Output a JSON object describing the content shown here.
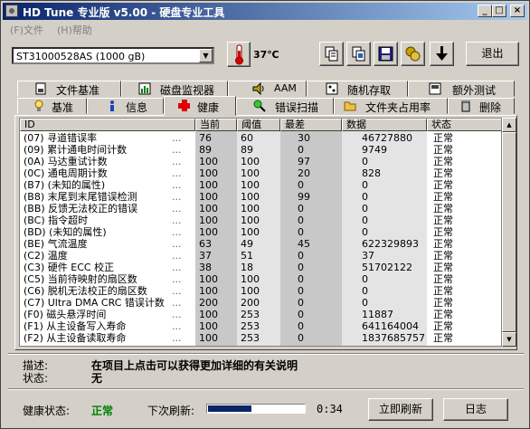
{
  "window": {
    "title": "HD Tune 专业版 v5.00 - 硬盘专业工具",
    "controls": {
      "minimize": "_",
      "maximize": "□",
      "close": "×"
    }
  },
  "menu": {
    "items": [
      "(F)文件",
      "(H)帮助"
    ]
  },
  "toolbar": {
    "drive": "ST31000528AS (1000 gB)",
    "temperature": "37℃",
    "exit_label": "退出",
    "icons": [
      "copy-text-icon",
      "copy-screen-icon",
      "save-icon",
      "options-icon",
      "download-icon"
    ]
  },
  "tabs": {
    "row1": [
      {
        "label": "文件基准",
        "icon": "file-benchmark-icon"
      },
      {
        "label": "磁盘监视器",
        "icon": "disk-monitor-icon"
      },
      {
        "label": "AAM",
        "icon": "speaker-icon"
      },
      {
        "label": "随机存取",
        "icon": "random-access-icon"
      },
      {
        "label": "额外测试",
        "icon": "extra-tests-icon"
      }
    ],
    "row2": [
      {
        "label": "基准",
        "icon": "benchmark-icon"
      },
      {
        "label": "信息",
        "icon": "info-icon"
      },
      {
        "label": "健康",
        "icon": "health-cross-icon",
        "active": true
      },
      {
        "label": "错误扫描",
        "icon": "error-scan-icon"
      },
      {
        "label": "文件夹占用率",
        "icon": "folder-usage-icon"
      },
      {
        "label": "删除",
        "icon": "erase-icon"
      }
    ]
  },
  "table": {
    "columns": [
      "ID",
      "当前",
      "阈值",
      "最差",
      "数据",
      "状态"
    ],
    "rows": [
      {
        "id": "(07) 寻道错误率",
        "cur": "76",
        "thr": "60",
        "worst": "30",
        "data": "46727880",
        "status": "正常"
      },
      {
        "id": "(09) 累计通电时间计数",
        "cur": "89",
        "thr": "89",
        "worst": "0",
        "data": "9749",
        "status": "正常"
      },
      {
        "id": "(0A) 马达重试计数",
        "cur": "100",
        "thr": "100",
        "worst": "97",
        "data": "0",
        "status": "正常"
      },
      {
        "id": "(0C) 通电周期计数",
        "cur": "100",
        "thr": "100",
        "worst": "20",
        "data": "828",
        "status": "正常"
      },
      {
        "id": "(B7) (未知的属性)",
        "cur": "100",
        "thr": "100",
        "worst": "0",
        "data": "0",
        "status": "正常"
      },
      {
        "id": "(B8) 末尾到末尾错误检测",
        "cur": "100",
        "thr": "100",
        "worst": "99",
        "data": "0",
        "status": "正常"
      },
      {
        "id": "(BB) 反馈无法校正的错误",
        "cur": "100",
        "thr": "100",
        "worst": "0",
        "data": "0",
        "status": "正常"
      },
      {
        "id": "(BC) 指令超时",
        "cur": "100",
        "thr": "100",
        "worst": "0",
        "data": "0",
        "status": "正常"
      },
      {
        "id": "(BD) (未知的属性)",
        "cur": "100",
        "thr": "100",
        "worst": "0",
        "data": "0",
        "status": "正常"
      },
      {
        "id": "(BE) 气流温度",
        "cur": "63",
        "thr": "49",
        "worst": "45",
        "data": "622329893",
        "status": "正常"
      },
      {
        "id": "(C2) 温度",
        "cur": "37",
        "thr": "51",
        "worst": "0",
        "data": "37",
        "status": "正常"
      },
      {
        "id": "(C3) 硬件 ECC 校正",
        "cur": "38",
        "thr": "18",
        "worst": "0",
        "data": "51702122",
        "status": "正常"
      },
      {
        "id": "(C5) 当前待映射的扇区数",
        "cur": "100",
        "thr": "100",
        "worst": "0",
        "data": "0",
        "status": "正常"
      },
      {
        "id": "(C6) 脱机无法校正的扇区数",
        "cur": "100",
        "thr": "100",
        "worst": "0",
        "data": "0",
        "status": "正常"
      },
      {
        "id": "(C7) Ultra DMA CRC 错误计数",
        "cur": "200",
        "thr": "200",
        "worst": "0",
        "data": "0",
        "status": "正常"
      },
      {
        "id": "(F0) 磁头悬浮时间",
        "cur": "100",
        "thr": "253",
        "worst": "0",
        "data": "11887",
        "status": "正常"
      },
      {
        "id": "(F1) 从主设备写入寿命",
        "cur": "100",
        "thr": "253",
        "worst": "0",
        "data": "641164004",
        "status": "正常"
      },
      {
        "id": "(F2) 从主设备读取寿命",
        "cur": "100",
        "thr": "253",
        "worst": "0",
        "data": "1837685757",
        "status": "正常"
      }
    ],
    "dots": "..."
  },
  "details": {
    "desc_label": "描述:",
    "desc_value": "在项目上点击可以获得更加详细的有关说明",
    "status_label": "状态:",
    "status_value": "无"
  },
  "footer": {
    "health_label": "健康状态:",
    "health_value": "正常",
    "health_color": "#008000",
    "refresh_label": "下次刷新:",
    "refresh_progress": 0.45,
    "countdown": "0:34",
    "refresh_now_label": "立即刷新",
    "log_label": "日志"
  }
}
